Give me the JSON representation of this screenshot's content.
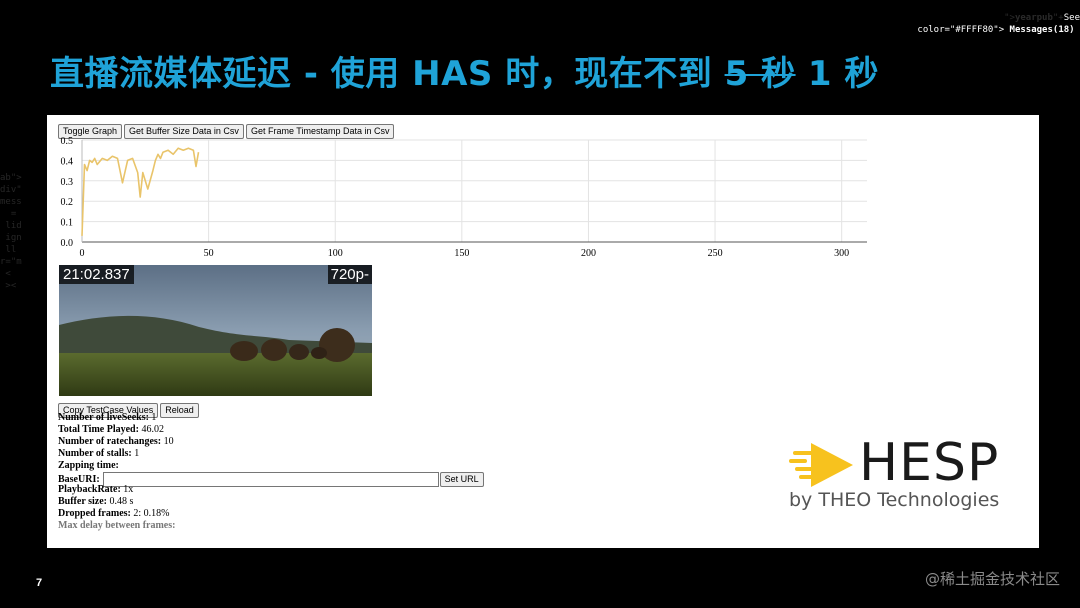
{
  "slide": {
    "title_main": "直播流媒体延迟 - 使用 HAS 时，现在不到 ",
    "title_strike": "5 秒",
    "title_end": " 1 秒",
    "page_number": "7",
    "watermark": "@稀土掘金技术社区"
  },
  "toolbar": {
    "toggle_graph": "Toggle Graph",
    "buffer_csv": "Get Buffer Size Data in Csv",
    "frame_csv": "Get Frame Timestamp Data in Csv"
  },
  "chart_data": {
    "type": "line",
    "title": "",
    "xlabel": "",
    "ylabel": "",
    "xlim": [
      0,
      310
    ],
    "ylim": [
      0,
      0.5
    ],
    "x_ticks": [
      0,
      50,
      100,
      150,
      200,
      250,
      300
    ],
    "y_ticks": [
      0.0,
      0.1,
      0.2,
      0.3,
      0.4,
      0.5
    ],
    "y_tick_labels": [
      "0.0",
      "0.1",
      "0.2",
      "0.3",
      "0.4",
      "0.5"
    ],
    "grid": true,
    "color": "#e9c46a",
    "series": [
      {
        "x": [
          0,
          1,
          2,
          3,
          4,
          5,
          6,
          8,
          10,
          12,
          14,
          16,
          18,
          20,
          22,
          23,
          24,
          26,
          28,
          29,
          30,
          31,
          32,
          34,
          36,
          38,
          40,
          42,
          44,
          45,
          46
        ],
        "y": [
          0.03,
          0.38,
          0.35,
          0.4,
          0.39,
          0.41,
          0.38,
          0.41,
          0.4,
          0.42,
          0.41,
          0.29,
          0.4,
          0.41,
          0.34,
          0.22,
          0.34,
          0.26,
          0.35,
          0.4,
          0.43,
          0.41,
          0.44,
          0.45,
          0.43,
          0.46,
          0.45,
          0.46,
          0.45,
          0.37,
          0.44
        ]
      }
    ]
  },
  "player": {
    "timestamp": "21:02.837",
    "resolution": "720p-"
  },
  "controls": {
    "copy_values": "Copy TestCase Values",
    "reload": "Reload",
    "set_url": "Set URL"
  },
  "stats": {
    "live_seeks_label": "Number of liveSeeks:",
    "live_seeks_value": "1",
    "time_played_label": "Total Time Played:",
    "time_played_value": "46.02",
    "ratechanges_label": "Number of ratechanges:",
    "ratechanges_value": "10",
    "stalls_label": "Number of stalls:",
    "stalls_value": "1",
    "zapping_label": "Zapping time:",
    "baseuri_label": "BaseURI:",
    "baseuri_value": "",
    "playback_label": "PlaybackRate:",
    "playback_value": "1x",
    "buffer_label": "Buffer size:",
    "buffer_value": "0.48 s",
    "dropped_label": "Dropped frames:",
    "dropped_value": "2: 0.18%",
    "max_delay_label": "Max delay between frames:"
  },
  "logo": {
    "word": "HESP",
    "sub": "by THEO Technologies",
    "accent": "#f7c21e"
  }
}
